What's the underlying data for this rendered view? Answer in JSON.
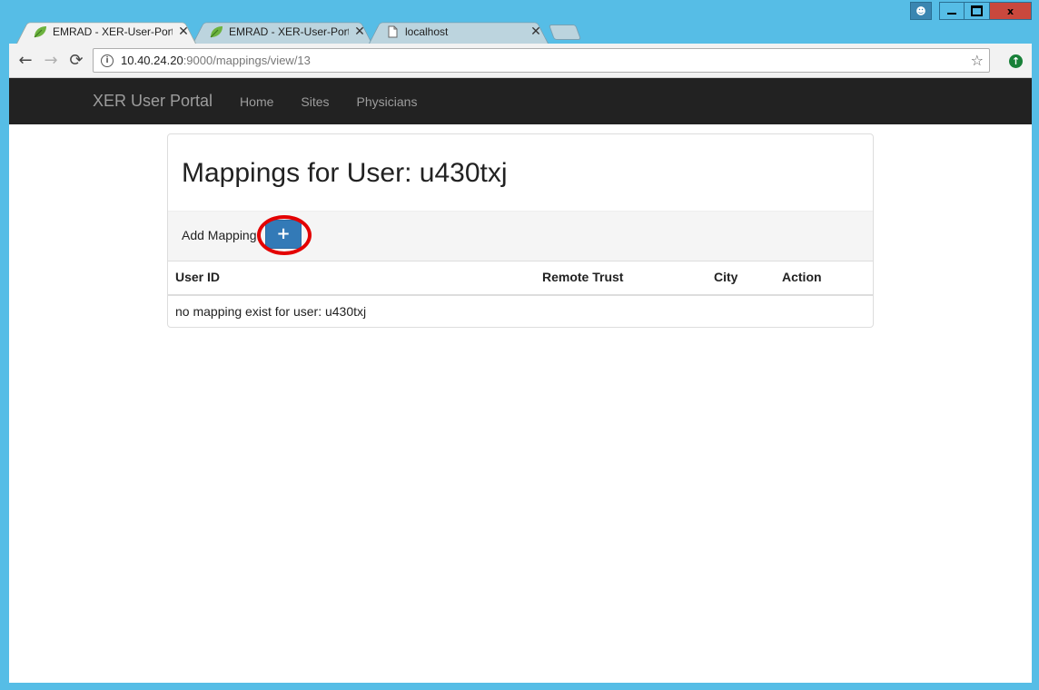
{
  "window": {
    "controls": {
      "user_icon": "user-icon",
      "minimize": "minimize",
      "maximize": "maximize",
      "close": "x"
    }
  },
  "tabs": [
    {
      "title": "EMRAD - XER-User-Porta",
      "icon": "leaf-icon",
      "active": true
    },
    {
      "title": "EMRAD - XER-User-Porta",
      "icon": "leaf-icon",
      "active": false
    },
    {
      "title": "localhost",
      "icon": "page-icon",
      "active": false
    }
  ],
  "toolbar": {
    "url_host": "10.40.24.20",
    "url_rest": ":9000/mappings/view/13"
  },
  "navbar": {
    "brand": "XER User Portal",
    "links": [
      "Home",
      "Sites",
      "Physicians"
    ]
  },
  "panel": {
    "title": "Mappings for User: u430txj",
    "add_label": "Add Mapping",
    "add_button": "+",
    "columns": [
      "User ID",
      "Remote Trust",
      "City",
      "Action"
    ],
    "empty_message": "no mapping exist for user: u430txj"
  },
  "colors": {
    "desktop": "#56bde6",
    "navbar": "#222222",
    "primary_button": "#337ab7",
    "highlight": "#e30000"
  }
}
